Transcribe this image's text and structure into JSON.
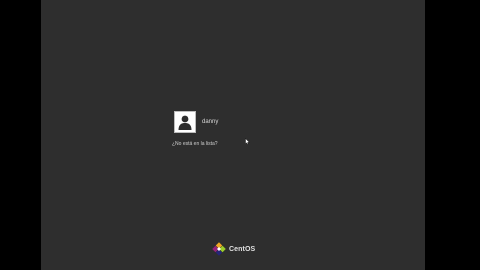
{
  "login": {
    "users": [
      {
        "name": "danny",
        "avatar_icon": "user-silhouette-icon"
      }
    ],
    "not_listed_link": "¿No está en la lista?"
  },
  "branding": {
    "logo_icon": "centos-logo-icon",
    "name": "CentOS"
  },
  "colors": {
    "background": "#2e2e2e",
    "letterbox": "#000000",
    "text": "#d8d8d8"
  }
}
